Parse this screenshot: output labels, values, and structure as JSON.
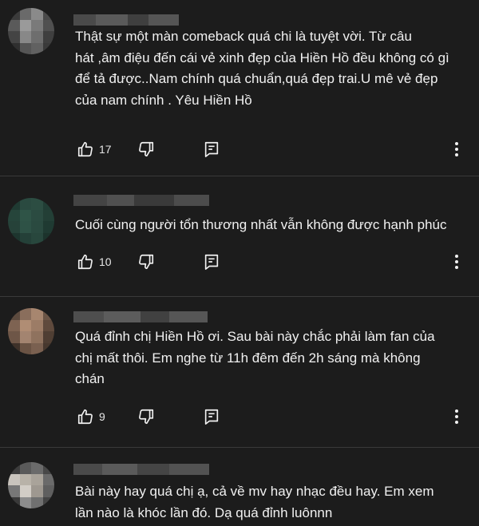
{
  "comments": [
    {
      "text": "Thật sự một màn comeback quá chi là tuyệt vời. Từ câu\nhát ,âm điệu đến cái vẻ xinh đẹp của Hiền Hồ đều không có gì\nđể tả được..Nam chính quá chuẩn,quá đẹp trai.U mê vẻ đẹp\ncủa nam chính . Yêu Hiền Hồ",
      "likes": "17",
      "avatar_colors": [
        "#3b3b3b",
        "#6a6a6a",
        "#8a8a8a",
        "#4a4a4a",
        "#5a5a5a",
        "#9a9a9a",
        "#7a7a7a",
        "#505050",
        "#444",
        "#888",
        "#6e6e6e",
        "#3f3f3f",
        "#2f2f2f",
        "#555",
        "#616161",
        "#3a3a3a"
      ],
      "author_colors": [
        "#4a4a4a",
        "#5a5a5a",
        "#3f3f3f",
        "#555555"
      ]
    },
    {
      "text": "Cuối cùng người tổn thương nhất vẫn không được hạnh phúc",
      "likes": "10",
      "avatar_colors": [
        "#1f3a32",
        "#2a4a40",
        "#2c4d42",
        "#213d35",
        "#26453b",
        "#2f5447",
        "#2b4b41",
        "#233f36",
        "#264239",
        "#2e5246",
        "#2a4a40",
        "#1f3a32",
        "#1d352e",
        "#244038",
        "#28473d",
        "#1c332c"
      ],
      "author_colors": [
        "#444444",
        "#505050",
        "#3a3a3a",
        "#4c4c4c"
      ]
    },
    {
      "text": "Quá đỉnh chị Hiền Hồ ơi. Sau bài này chắc phải làm fan của\nchị mất thôi. Em nghe từ 11h đêm đến 2h sáng mà không\nchán",
      "likes": "9",
      "avatar_colors": [
        "#5c4a3e",
        "#8a6e5c",
        "#a7866f",
        "#6b5546",
        "#7e6352",
        "#b08d74",
        "#9c7c66",
        "#5f4a3d",
        "#6e5647",
        "#a38470",
        "#8f725e",
        "#4f3e33",
        "#3e3129",
        "#6a5344",
        "#7a6050",
        "#47382e"
      ],
      "author_colors": [
        "#4e4e4e",
        "#5c5c5c",
        "#414141",
        "#565656"
      ]
    },
    {
      "text": "Bài này hay quá chị ạ, cả về mv hay nhạc đều hay. Em xem\nlần nào là khóc lần đó. Dạ quá đỉnh luônnn",
      "likes": "",
      "avatar_colors": [
        "#3d3d3d",
        "#5a5a5a",
        "#6b6b6b",
        "#484848",
        "#c9c4bd",
        "#b8b2a8",
        "#a9a39a",
        "#6a6a6a",
        "#777",
        "#d2cdc6",
        "#9e9890",
        "#5f5f5f",
        "#3a3a3a",
        "#8c8c8c",
        "#707070",
        "#444"
      ],
      "author_colors": [
        "#4a4a4a",
        "#5a5a5a",
        "#454545",
        "#525252"
      ]
    }
  ],
  "icons": {
    "like": "thumb-up-icon",
    "dislike": "thumb-down-icon",
    "reply": "reply-comment-icon",
    "more": "more-vertical-icon"
  }
}
